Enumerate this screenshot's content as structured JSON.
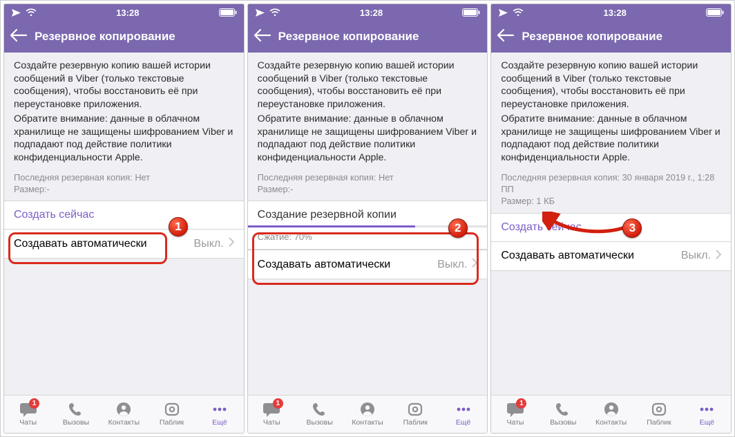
{
  "status": {
    "time": "13:28"
  },
  "header": {
    "title": "Резервное копирование"
  },
  "info": {
    "p1": "Создайте резервную копию вашей истории сообщений в Viber (только текстовые сообщения), чтобы восстановить её при переустановке приложения.",
    "p2": "Обратите внимание: данные в облачном хранилище не защищены шифрованием Viber и подпадают под действие политики конфиденциальности Apple."
  },
  "meta_none": {
    "last": "Последняя резервная копия: Нет",
    "size": "Размер:-"
  },
  "meta_done": {
    "last": "Последняя резервная копия: 30 января 2019 г., 1:28 ПП",
    "size": "Размер: 1 КБ"
  },
  "actions": {
    "create_now": "Создать сейчас",
    "creating": "Создание резервной копии",
    "compress": "Сжатие: 70%",
    "progress_pct": 70,
    "auto": "Создавать автоматически",
    "auto_value": "Выкл."
  },
  "tabs": {
    "chats": "Чаты",
    "calls": "Вызовы",
    "contacts": "Контакты",
    "public": "Паблик",
    "more": "Ещё",
    "badge": "1"
  },
  "annot": {
    "n1": "1",
    "n2": "2",
    "n3": "3"
  }
}
